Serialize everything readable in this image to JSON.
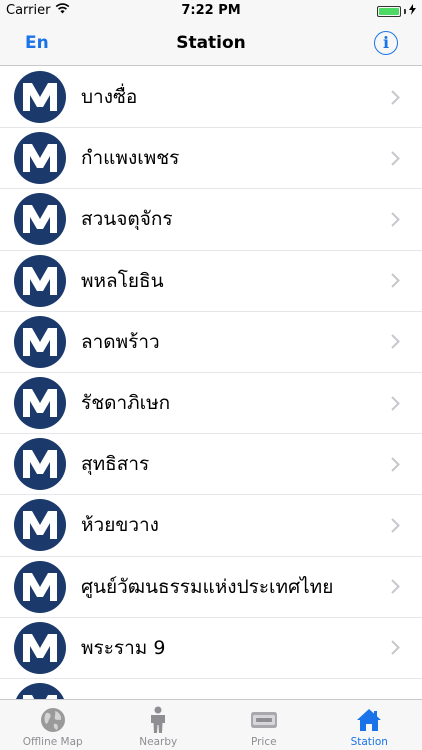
{
  "status": {
    "carrier": "Carrier",
    "time": "7:22 PM"
  },
  "nav": {
    "left": "En",
    "title": "Station"
  },
  "stations": [
    {
      "name": "บางซื่อ"
    },
    {
      "name": "กำแพงเพชร"
    },
    {
      "name": "สวนจตุจักร"
    },
    {
      "name": "พหลโยธิน"
    },
    {
      "name": "ลาดพร้าว"
    },
    {
      "name": "รัชดาภิเษก"
    },
    {
      "name": "สุทธิสาร"
    },
    {
      "name": "ห้วยขวาง"
    },
    {
      "name": "ศูนย์วัฒนธรรมแห่งประเทศไทย"
    },
    {
      "name": "พระราม 9"
    },
    {
      "name": ""
    }
  ],
  "tabs": [
    {
      "label": "Offline Map",
      "icon": "globe-icon"
    },
    {
      "label": "Nearby",
      "icon": "person-icon"
    },
    {
      "label": "Price",
      "icon": "card-icon"
    },
    {
      "label": "Station",
      "icon": "home-icon"
    }
  ],
  "colors": {
    "accent": "#1a73e8",
    "logo_navy": "#1b3a6b"
  }
}
